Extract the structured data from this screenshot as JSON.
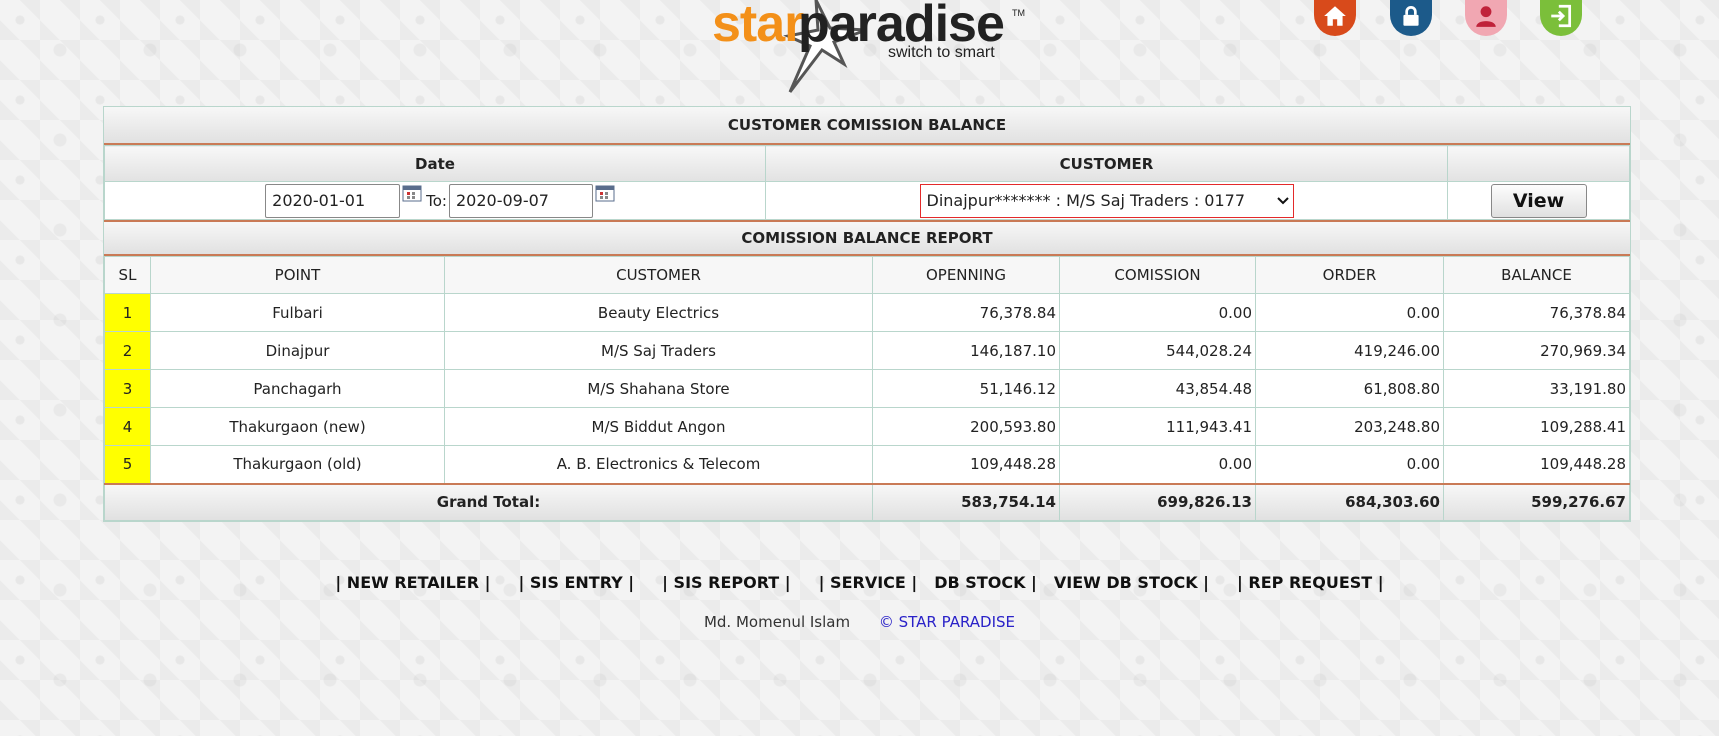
{
  "brand": {
    "name_part1": "star",
    "name_part2": "paradise",
    "tm": "TM",
    "tagline": "switch to smart"
  },
  "nav_icons": [
    {
      "name": "home-icon",
      "color": "#d84a1b"
    },
    {
      "name": "lock-icon",
      "color": "#1c5a8a"
    },
    {
      "name": "user-icon",
      "color": "#f1a7b2"
    },
    {
      "name": "logout-icon",
      "color": "#7bbf3a"
    }
  ],
  "panel": {
    "title": "CUSTOMER COMISSION BALANCE",
    "date_label": "Date",
    "customer_label": "CUSTOMER",
    "date_from": "2020-01-01",
    "to_label": "To:",
    "date_to": "2020-09-07",
    "customer_value": "Dinajpur******* : M/S Saj Traders : 0177",
    "view_label": "View",
    "report_title": "COMISSION BALANCE REPORT"
  },
  "report": {
    "columns": [
      "SL",
      "POINT",
      "CUSTOMER",
      "OPENNING",
      "COMISSION",
      "ORDER",
      "BALANCE"
    ],
    "rows": [
      [
        "1",
        "Fulbari",
        "Beauty Electrics",
        "76,378.84",
        "0.00",
        "0.00",
        "76,378.84"
      ],
      [
        "2",
        "Dinajpur",
        "M/S Saj Traders",
        "146,187.10",
        "544,028.24",
        "419,246.00",
        "270,969.34"
      ],
      [
        "3",
        "Panchagarh",
        "M/S Shahana Store",
        "51,146.12",
        "43,854.48",
        "61,808.80",
        "33,191.80"
      ],
      [
        "4",
        "Thakurgaon (new)",
        "M/S Biddut Angon",
        "200,593.80",
        "111,943.41",
        "203,248.80",
        "109,288.41"
      ],
      [
        "5",
        "Thakurgaon (old)",
        "A. B. Electronics & Telecom",
        "109,448.28",
        "0.00",
        "0.00",
        "109,448.28"
      ]
    ],
    "grand_total_label": "Grand Total:",
    "grand_total": [
      "583,754.14",
      "699,826.13",
      "684,303.60",
      "599,276.67"
    ]
  },
  "footer": {
    "links": [
      "| NEW RETAILER |",
      "| SIS ENTRY |",
      "| SIS REPORT |",
      "| SERVICE |",
      "DB STOCK |",
      "VIEW DB STOCK |",
      "| REP REQUEST |"
    ],
    "author": "Md. Momenul Islam",
    "copyright": "© STAR PARADISE"
  }
}
